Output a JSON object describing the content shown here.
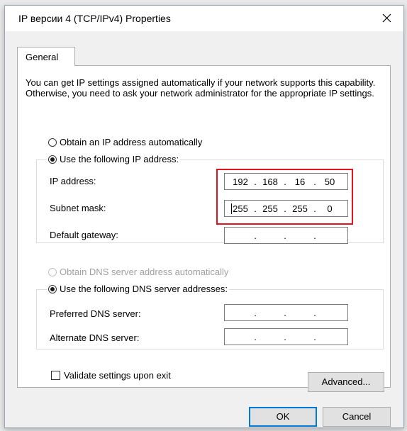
{
  "window": {
    "title": "IP версии 4 (TCP/IPv4) Properties",
    "close_icon": "close-icon"
  },
  "tabs": [
    {
      "label": "General",
      "active": true
    }
  ],
  "description": "You can get IP settings assigned automatically if your network supports this capability. Otherwise, you need to ask your network administrator for the appropriate IP settings.",
  "ip_section": {
    "auto_label": "Obtain an IP address automatically",
    "manual_label": "Use the following IP address:",
    "selected": "manual",
    "fields": [
      {
        "label": "IP address:",
        "octets": [
          "192",
          "168",
          "16",
          "50"
        ]
      },
      {
        "label": "Subnet mask:",
        "octets": [
          "255",
          "255",
          "255",
          "0"
        ]
      },
      {
        "label": "Default gateway:",
        "octets": [
          "",
          "",
          "",
          ""
        ]
      }
    ]
  },
  "dns_section": {
    "auto_label": "Obtain DNS server address automatically",
    "manual_label": "Use the following DNS server addresses:",
    "selected": "manual",
    "auto_disabled": true,
    "fields": [
      {
        "label": "Preferred DNS server:",
        "octets": [
          "",
          "",
          "",
          ""
        ]
      },
      {
        "label": "Alternate DNS server:",
        "octets": [
          "",
          "",
          "",
          ""
        ]
      }
    ]
  },
  "validate": {
    "label": "Validate settings upon exit",
    "checked": false
  },
  "buttons": {
    "advanced": "Advanced...",
    "ok": "OK",
    "cancel": "Cancel"
  },
  "colors": {
    "highlight": "#e0141f",
    "default_button_border": "#0078d7"
  }
}
